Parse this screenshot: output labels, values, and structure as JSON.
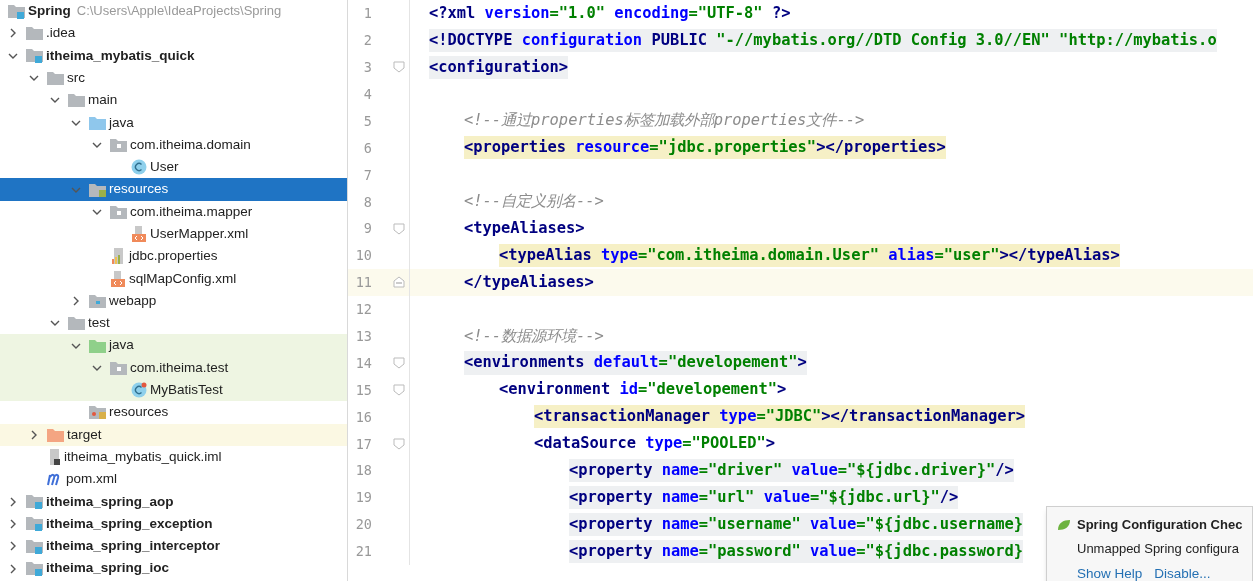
{
  "project_tree": {
    "root": {
      "name": "Spring",
      "path": "C:\\Users\\Apple\\IdeaProjects\\Spring",
      "kind": "module"
    },
    "items": [
      {
        "name": ".idea",
        "kind": "folder",
        "expanded": false,
        "selected": false
      },
      {
        "name": "itheima_mybatis_quick",
        "kind": "module",
        "expanded": true,
        "selected": false,
        "children": [
          {
            "name": "src",
            "kind": "folder",
            "expanded": true,
            "selected": false,
            "children": [
              {
                "name": "main",
                "kind": "folder",
                "expanded": true,
                "selected": false,
                "children": [
                  {
                    "name": "java",
                    "kind": "source",
                    "expanded": true,
                    "selected": false,
                    "children": [
                      {
                        "name": "com.itheima.domain",
                        "kind": "package",
                        "expanded": true,
                        "selected": false,
                        "children": [
                          {
                            "name": "User",
                            "kind": "class",
                            "selected": false
                          }
                        ]
                      }
                    ]
                  },
                  {
                    "name": "resources",
                    "kind": "resources",
                    "expanded": true,
                    "selected": true,
                    "children": [
                      {
                        "name": "com.itheima.mapper",
                        "kind": "package",
                        "expanded": true,
                        "selected": false,
                        "children": [
                          {
                            "name": "UserMapper.xml",
                            "kind": "xml",
                            "selected": false
                          }
                        ]
                      },
                      {
                        "name": "jdbc.properties",
                        "kind": "properties",
                        "selected": false
                      },
                      {
                        "name": "sqlMapConfig.xml",
                        "kind": "xml",
                        "selected": false
                      }
                    ]
                  },
                  {
                    "name": "webapp",
                    "kind": "web",
                    "expanded": false,
                    "selected": false
                  }
                ]
              },
              {
                "name": "test",
                "kind": "folder",
                "expanded": true,
                "selected": false,
                "children": [
                  {
                    "name": "java",
                    "kind": "testsource",
                    "expanded": true,
                    "selected": false,
                    "children": [
                      {
                        "name": "com.itheima.test",
                        "kind": "package",
                        "expanded": true,
                        "selected": false,
                        "children": [
                          {
                            "name": "MyBatisTest",
                            "kind": "testclass",
                            "selected": false
                          }
                        ]
                      }
                    ]
                  },
                  {
                    "name": "resources",
                    "kind": "testresources",
                    "selected": false
                  }
                ]
              }
            ]
          },
          {
            "name": "target",
            "kind": "excluded",
            "expanded": false,
            "selected": false
          },
          {
            "name": "itheima_mybatis_quick.iml",
            "kind": "iml",
            "selected": false
          },
          {
            "name": "pom.xml",
            "kind": "maven",
            "selected": false
          }
        ]
      },
      {
        "name": "itheima_spring_aop",
        "kind": "module",
        "expanded": false,
        "selected": false
      },
      {
        "name": "itheima_spring_exception",
        "kind": "module",
        "expanded": false,
        "selected": false
      },
      {
        "name": "itheima_spring_interceptor",
        "kind": "module",
        "expanded": false,
        "selected": false
      },
      {
        "name": "itheima_spring_ioc",
        "kind": "module",
        "expanded": false,
        "selected": false
      }
    ]
  },
  "editor": {
    "lines": [
      {
        "number": "1",
        "kind": "plain",
        "tokens": [
          {
            "kind": "tag",
            "text": "<?xml "
          },
          {
            "kind": "attr",
            "text": "version"
          },
          {
            "kind": "str",
            "text": "=\"1.0\" "
          },
          {
            "kind": "attr",
            "text": "encoding"
          },
          {
            "kind": "str",
            "text": "=\"UTF-8\""
          },
          {
            "kind": "tag",
            "text": " ?>"
          }
        ]
      },
      {
        "number": "2",
        "kind": "matched",
        "tokens": [
          {
            "kind": "tag",
            "text": "<!DOCTYPE "
          },
          {
            "kind": "attr",
            "text": "configuration "
          },
          {
            "kind": "tag",
            "text": "PUBLIC "
          },
          {
            "kind": "str",
            "text": "\"-//mybatis.org//DTD Config 3.0//EN\" \"http://mybatis.o"
          }
        ]
      },
      {
        "number": "3",
        "kind": "matched",
        "fold_start": true,
        "tokens": [
          {
            "kind": "tag",
            "text": "<configuration>"
          }
        ],
        "children": [
          {
            "number": "4"
          },
          {
            "number": "5",
            "kind": "plain",
            "tokens": [
              {
                "kind": "comment",
                "text": "<!--通过properties标签加载外部properties文件-->"
              }
            ]
          },
          {
            "number": "6",
            "kind": "usage",
            "tokens": [
              {
                "kind": "tag",
                "text": "<properties "
              },
              {
                "kind": "attr",
                "text": "resource"
              },
              {
                "kind": "str",
                "text": "=\"jdbc.properties\""
              },
              {
                "kind": "tag",
                "text": "></properties>"
              }
            ]
          },
          {
            "number": "7"
          },
          {
            "number": "8",
            "kind": "plain",
            "tokens": [
              {
                "kind": "comment",
                "text": "<!--自定义别名-->"
              }
            ]
          },
          {
            "number": "9",
            "kind": "plain",
            "fold_start": true,
            "tokens": [
              {
                "kind": "tag",
                "text": "<typeAliases>"
              }
            ],
            "children": [
              {
                "number": "10",
                "kind": "usage",
                "tokens": [
                  {
                    "kind": "tag",
                    "text": "<typeAlias "
                  },
                  {
                    "kind": "attr",
                    "text": "type"
                  },
                  {
                    "kind": "str",
                    "text": "=\"com.itheima.domain.User\" "
                  },
                  {
                    "kind": "attr",
                    "text": "alias"
                  },
                  {
                    "kind": "str",
                    "text": "=\"user\""
                  },
                  {
                    "kind": "tag",
                    "text": "></typeAlias>"
                  }
                ]
              }
            ]
          },
          {
            "number": "11",
            "kind": "plain",
            "current": true,
            "fold_end": true,
            "tokens": [
              {
                "kind": "tag",
                "text": "</typeAliases>"
              }
            ]
          },
          {
            "number": "12"
          },
          {
            "number": "13",
            "kind": "plain",
            "tokens": [
              {
                "kind": "comment",
                "text": "<!--数据源环境-->"
              }
            ]
          },
          {
            "number": "14",
            "kind": "matched",
            "fold_start": true,
            "tokens": [
              {
                "kind": "tag",
                "text": "<environments "
              },
              {
                "kind": "attr",
                "text": "default"
              },
              {
                "kind": "str",
                "text": "=\"developement\""
              },
              {
                "kind": "tag",
                "text": ">"
              }
            ],
            "children": [
              {
                "number": "15",
                "kind": "plain",
                "fold_start": true,
                "tokens": [
                  {
                    "kind": "tag",
                    "text": "<environment "
                  },
                  {
                    "kind": "attr",
                    "text": "id"
                  },
                  {
                    "kind": "str",
                    "text": "=\"developement\""
                  },
                  {
                    "kind": "tag",
                    "text": ">"
                  }
                ],
                "children": [
                  {
                    "number": "16",
                    "kind": "usage",
                    "tokens": [
                      {
                        "kind": "tag",
                        "text": "<transactionManager "
                      },
                      {
                        "kind": "attr",
                        "text": "type"
                      },
                      {
                        "kind": "str",
                        "text": "=\"JDBC\""
                      },
                      {
                        "kind": "tag",
                        "text": "></transactionManager>"
                      }
                    ]
                  },
                  {
                    "number": "17",
                    "kind": "plain",
                    "fold_start": true,
                    "tokens": [
                      {
                        "kind": "tag",
                        "text": "<dataSource "
                      },
                      {
                        "kind": "attr",
                        "text": "type"
                      },
                      {
                        "kind": "str",
                        "text": "=\"POOLED\""
                      },
                      {
                        "kind": "tag",
                        "text": ">"
                      }
                    ],
                    "children": [
                      {
                        "number": "18",
                        "kind": "matched",
                        "tokens": [
                          {
                            "kind": "tag",
                            "text": "<property "
                          },
                          {
                            "kind": "attr",
                            "text": "name"
                          },
                          {
                            "kind": "str",
                            "text": "=\"driver\" "
                          },
                          {
                            "kind": "attr",
                            "text": "value"
                          },
                          {
                            "kind": "str",
                            "text": "=\"${jdbc.driver}\""
                          },
                          {
                            "kind": "tag",
                            "text": "/>"
                          }
                        ]
                      },
                      {
                        "number": "19",
                        "kind": "matched",
                        "tokens": [
                          {
                            "kind": "tag",
                            "text": "<property "
                          },
                          {
                            "kind": "attr",
                            "text": "name"
                          },
                          {
                            "kind": "str",
                            "text": "=\"url\" "
                          },
                          {
                            "kind": "attr",
                            "text": "value"
                          },
                          {
                            "kind": "str",
                            "text": "=\"${jdbc.url}\""
                          },
                          {
                            "kind": "tag",
                            "text": "/>"
                          }
                        ]
                      },
                      {
                        "number": "20",
                        "kind": "matched",
                        "tokens": [
                          {
                            "kind": "tag",
                            "text": "<property "
                          },
                          {
                            "kind": "attr",
                            "text": "name"
                          },
                          {
                            "kind": "str",
                            "text": "=\"username\" "
                          },
                          {
                            "kind": "attr",
                            "text": "value"
                          },
                          {
                            "kind": "str",
                            "text": "=\"${jdbc.username}"
                          }
                        ]
                      },
                      {
                        "number": "21",
                        "kind": "matched",
                        "tokens": [
                          {
                            "kind": "tag",
                            "text": "<property "
                          },
                          {
                            "kind": "attr",
                            "text": "name"
                          },
                          {
                            "kind": "str",
                            "text": "=\"password\" "
                          },
                          {
                            "kind": "attr",
                            "text": "value"
                          },
                          {
                            "kind": "str",
                            "text": "=\"${jdbc.password}"
                          }
                        ]
                      }
                    ]
                  }
                ]
              }
            ]
          }
        ]
      }
    ]
  },
  "notification": {
    "title": "Spring Configuration Chec",
    "message": "Unmapped Spring configura",
    "actions": [
      "Show Help",
      "Disable..."
    ]
  }
}
